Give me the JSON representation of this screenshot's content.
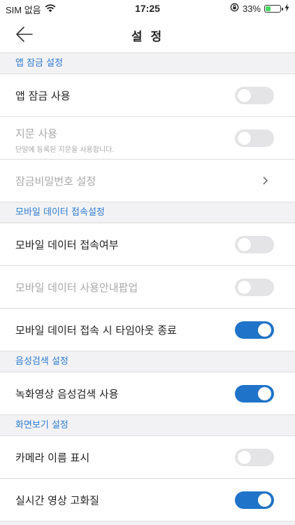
{
  "status_bar": {
    "carrier": "SIM 없음",
    "time": "17:25",
    "battery_percent": "33%",
    "battery_level": 0.33
  },
  "nav": {
    "title": "설 정"
  },
  "sections": [
    {
      "header": "앱 잠금 설정",
      "rows": [
        {
          "label": "앱 잠금 사용",
          "type": "toggle",
          "on": false,
          "enabled": true
        },
        {
          "label": "지문 사용",
          "sub": "단말에 등록된 지문을 사용합니다.",
          "type": "toggle",
          "on": false,
          "enabled": false
        },
        {
          "label": "잠금비밀번호 설정",
          "type": "chevron",
          "enabled": false
        }
      ]
    },
    {
      "header": "모바일 데이터 접속설정",
      "rows": [
        {
          "label": "모바일 데이터 접속여부",
          "type": "toggle",
          "on": false,
          "enabled": true
        },
        {
          "label": "모바일 데이터 사용안내팝업",
          "type": "toggle",
          "on": false,
          "enabled": false
        },
        {
          "label": "모바일 데이터 접속 시 타임아웃 종료",
          "type": "toggle",
          "on": true,
          "enabled": true
        }
      ]
    },
    {
      "header": "음성검색 설정",
      "rows": [
        {
          "label": "녹화영상 음성검색 사용",
          "type": "toggle",
          "on": true,
          "enabled": true
        }
      ]
    },
    {
      "header": "화면보기 설정",
      "rows": [
        {
          "label": "카메라 이름 표시",
          "type": "toggle",
          "on": false,
          "enabled": true
        },
        {
          "label": "실시간 영상 고화질",
          "type": "toggle",
          "on": true,
          "enabled": true
        }
      ]
    }
  ],
  "colors": {
    "accent": "#1f73c9",
    "section_text": "#2c7bd1",
    "disabled_text": "#a8a8a8",
    "toggle_off": "#e4e4e6"
  }
}
